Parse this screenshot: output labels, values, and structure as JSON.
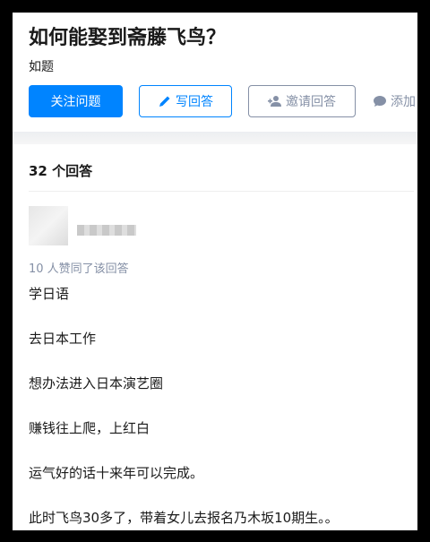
{
  "question": {
    "title": "如何能娶到斋藤飞鸟？",
    "description": "如题"
  },
  "actions": {
    "follow_label": "关注问题",
    "write_label": "写回答",
    "invite_label": "邀请回答",
    "comment_label": "添加"
  },
  "answers": {
    "count_label": "32 个回答"
  },
  "answer": {
    "votes_label": "10 人赞同了该回答",
    "paragraphs": [
      "学日语",
      "去日本工作",
      "想办法进入日本演艺圈",
      "赚钱往上爬，上红白",
      "运气好的话十来年可以完成。",
      "此时飞鸟30多了，带着女儿去报名乃木坂10期生。。"
    ]
  },
  "colors": {
    "brand": "#0084ff",
    "muted": "#8590a6"
  }
}
